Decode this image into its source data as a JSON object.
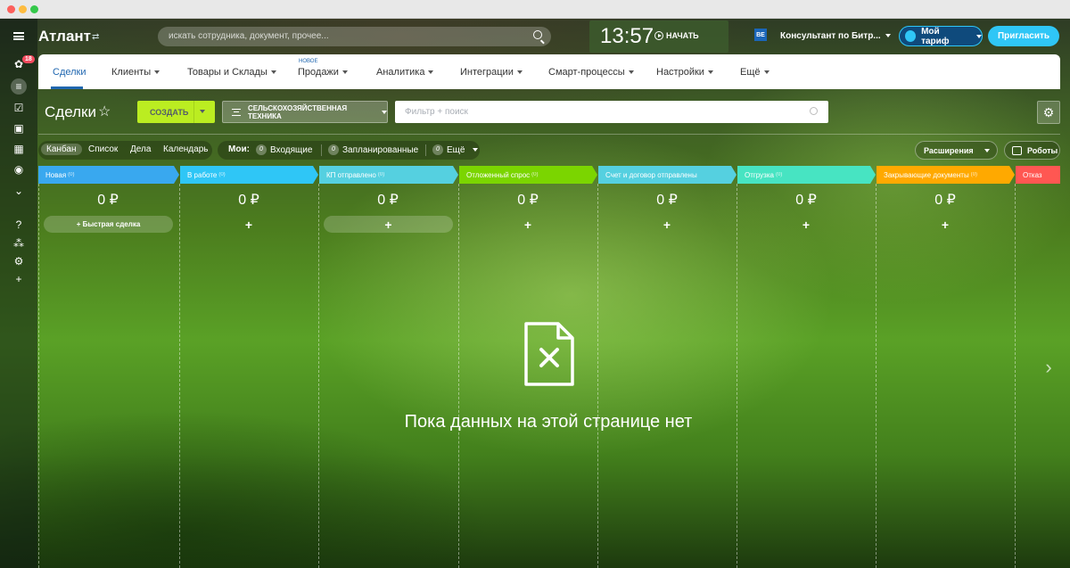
{
  "window": {
    "dots": [
      "#fc605c",
      "#fdbc40",
      "#34c84a"
    ]
  },
  "app": {
    "logo": "Атлант",
    "swap_icon": "swap-icon"
  },
  "search": {
    "placeholder": "искать сотрудника, документ, прочее..."
  },
  "clock": {
    "time": "13:57",
    "start_label": "НАЧАТЬ"
  },
  "consultant": {
    "label": "Консультант по Битр..."
  },
  "tariff": {
    "label": "Мой тариф"
  },
  "invite": {
    "label": "Пригласить"
  },
  "sidebar": {
    "badge": "18"
  },
  "nav": {
    "items": [
      "Сделки",
      "Клиенты",
      "Товары и Склады",
      "Продажи",
      "Аналитика",
      "Интеграции",
      "Смарт-процессы",
      "Настройки",
      "Ещё"
    ],
    "new_badge": "НОВОЕ"
  },
  "page": {
    "title": "Сделки"
  },
  "toolbar": {
    "create_label": "СОЗДАТЬ",
    "category_label": "СЕЛЬСКОХОЗЯЙСТВЕННАЯ ТЕХНИКА",
    "filter_placeholder": "Фильтр + поиск"
  },
  "views": [
    "Канбан",
    "Список",
    "Дела",
    "Календарь"
  ],
  "my": {
    "label": "Мои:",
    "items": [
      {
        "count": "0",
        "label": "Входящие"
      },
      {
        "count": "0",
        "label": "Запланированные"
      },
      {
        "count": "0",
        "label": "Ещё"
      }
    ]
  },
  "extensions_label": "Расширения",
  "robots_label": "Роботы",
  "stages": [
    {
      "name": "Новая",
      "count": "(0)",
      "sum": "0 ₽",
      "color": "#39a8ef"
    },
    {
      "name": "В работе",
      "count": "(0)",
      "sum": "0 ₽",
      "color": "#2fc6f6"
    },
    {
      "name": "КП отправлено",
      "count": "(0)",
      "sum": "0 ₽",
      "color": "#55d0e0"
    },
    {
      "name": "Отложенный спрос",
      "count": "(0)",
      "sum": "0 ₽",
      "color": "#47e4c2"
    },
    {
      "name": "Счет и договор отправлены",
      "count": "(0)",
      "sum": "0 ₽",
      "color": "#47e4c2"
    },
    {
      "name": "Отгрузка",
      "count": "(0)",
      "sum": "0 ₽",
      "color": "#47e4c2"
    },
    {
      "name": "Закрывающие документы",
      "count": "(0)",
      "sum": "0 ₽",
      "color": "#ffa900"
    },
    {
      "name": "Отказ",
      "count": "(0)",
      "sum": "",
      "color": "#ff5752"
    }
  ],
  "quick_deal": "+ Быстрая сделка",
  "plus": "+",
  "empty_text": "Пока данных на этой странице нет"
}
